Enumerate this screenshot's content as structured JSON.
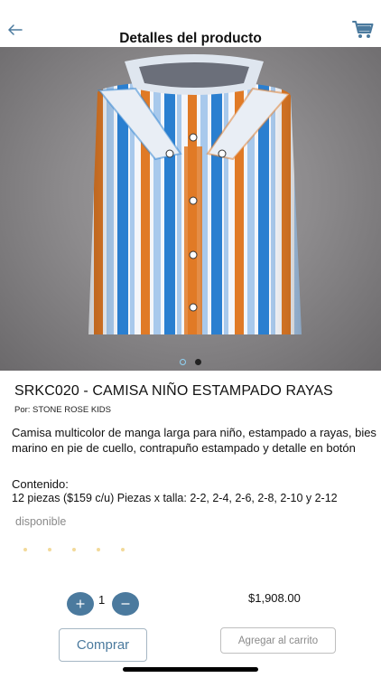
{
  "header": {
    "title": "Detalles del producto",
    "back_icon": "arrow-left-icon",
    "cart_icon": "shopping-cart-icon",
    "accent_color": "#4b7a9e"
  },
  "carousel": {
    "image": "striped-shirt-photo",
    "pages": 2,
    "active_page": 2
  },
  "product": {
    "name": "SRKC020 - CAMISA NIÑO ESTAMPADO RAYAS",
    "brand": "Por: STONE ROSE KIDS",
    "description": "Camisa multicolor de manga larga para niño, estampado a rayas, bies marino en pie de cuello, contrapuño estampado y detalle en botón",
    "contents_label": "Contenido:",
    "contents_detail": "12 piezas ($159 c/u) Piezas x talla: 2-2, 2-4, 2-6, 2-8, 2-10 y 2-12",
    "availability": "disponible",
    "rating_stars": 5
  },
  "order": {
    "quantity": "1",
    "plus_icon": "plus-icon",
    "minus_icon": "minus-icon",
    "total": "$1,908.00",
    "buy_label": "Comprar",
    "add_to_cart_label": "Agregar al carrito"
  }
}
